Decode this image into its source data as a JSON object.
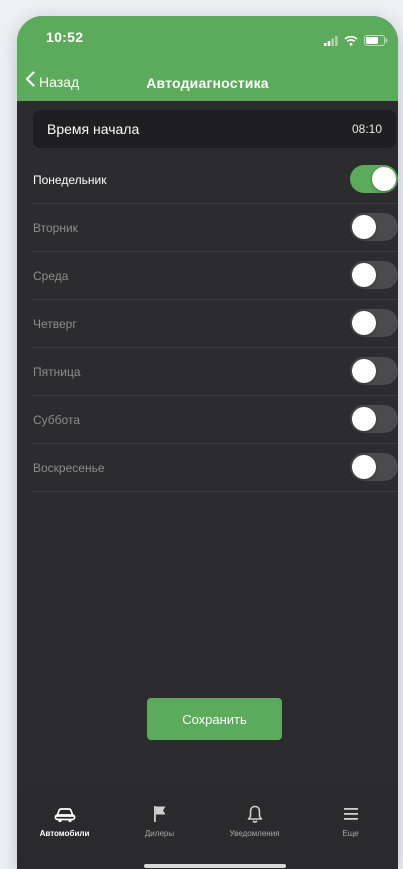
{
  "status_bar": {
    "time": "10:52",
    "icons": [
      "signal-icon",
      "wifi-icon",
      "battery-icon"
    ]
  },
  "nav": {
    "back_label": "Назад",
    "title": "Автодиагностика"
  },
  "start_time": {
    "label": "Время начала",
    "value": "08:10"
  },
  "days": [
    {
      "label": "Понедельник",
      "enabled": true
    },
    {
      "label": "Вторник",
      "enabled": false
    },
    {
      "label": "Среда",
      "enabled": false
    },
    {
      "label": "Четверг",
      "enabled": false
    },
    {
      "label": "Пятница",
      "enabled": false
    },
    {
      "label": "Суббота",
      "enabled": false
    },
    {
      "label": "Воскресенье",
      "enabled": false
    }
  ],
  "save_label": "Сохранить",
  "tabs": [
    {
      "label": "Автомобили",
      "icon": "car-icon",
      "active": true
    },
    {
      "label": "Дилеры",
      "icon": "flag-icon",
      "active": false
    },
    {
      "label": "Уведомления",
      "icon": "bell-icon",
      "active": false
    },
    {
      "label": "Еще",
      "icon": "menu-icon",
      "active": false
    }
  ],
  "colors": {
    "accent": "#5cab5c",
    "background": "#2c2c2e",
    "row_background": "#1f1f21",
    "toggle_off": "#4b4b4e"
  }
}
